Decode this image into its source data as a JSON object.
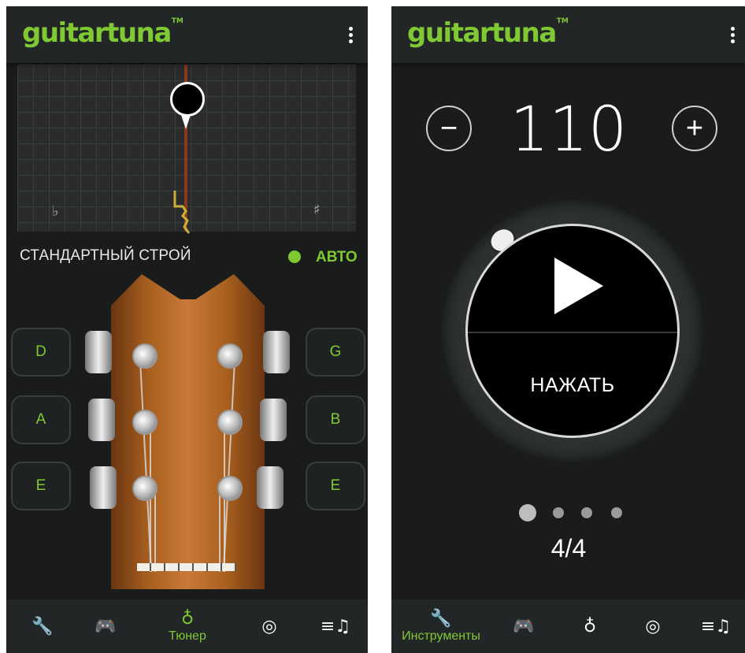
{
  "left": {
    "brand": {
      "name": "guitartuna",
      "tm": "TM"
    },
    "tuner": {
      "flat_symbol": "♭",
      "sharp_symbol": "♯"
    },
    "tuning": {
      "label": "СТАНДАРТНЫЙ СТРОЙ",
      "auto_label": "АВТО"
    },
    "strings_left": [
      "D",
      "A",
      "E"
    ],
    "strings_right": [
      "G",
      "B",
      "E"
    ],
    "nav": {
      "tools_icon": "wrench-icon",
      "games_icon": "gamepad-icon",
      "tuner_label": "Тюнер",
      "fingerprint_icon": "fingerprint-icon",
      "songs_icon": "song-list-icon"
    }
  },
  "right": {
    "brand": {
      "name": "guitartuna",
      "tm": "TM"
    },
    "metronome": {
      "minus": "−",
      "plus": "+",
      "bpm": "110",
      "tap_label": "НАЖАТЬ",
      "time_signature": "4/4",
      "beats": 4,
      "current_beat": 1
    },
    "nav": {
      "tools_label": "Инструменты"
    }
  },
  "colors": {
    "accent": "#7fc933",
    "background": "#1a1c1c",
    "bar": "#232626"
  }
}
